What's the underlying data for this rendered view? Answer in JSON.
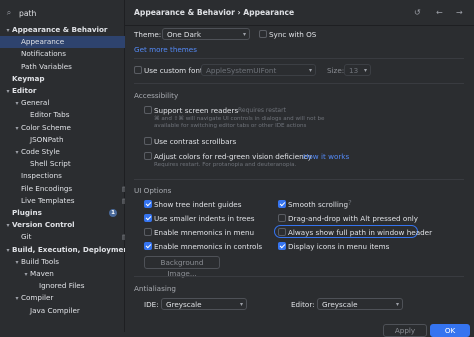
{
  "search": {
    "value": "path"
  },
  "tree": [
    {
      "label": "Appearance & Behavior",
      "arrow": "▾"
    },
    {
      "label": "Appearance"
    },
    {
      "label": "Notifications"
    },
    {
      "label": "Path Variables"
    },
    {
      "label": "Keymap"
    },
    {
      "label": "Editor",
      "arrow": "▾"
    },
    {
      "label": "General",
      "arrow": "▾"
    },
    {
      "label": "Editor Tabs"
    },
    {
      "label": "Color Scheme",
      "arrow": "▾"
    },
    {
      "label": "JSONPath"
    },
    {
      "label": "Code Style",
      "arrow": "▾"
    },
    {
      "label": "Shell Script"
    },
    {
      "label": "Inspections"
    },
    {
      "label": "File Encodings"
    },
    {
      "label": "Live Templates"
    },
    {
      "label": "Plugins",
      "badge": "1"
    },
    {
      "label": "Version Control",
      "arrow": "▾"
    },
    {
      "label": "Git"
    },
    {
      "label": "Build, Execution, Deployment",
      "arrow": "▾"
    },
    {
      "label": "Build Tools",
      "arrow": "▾"
    },
    {
      "label": "Maven",
      "arrow": "▾"
    },
    {
      "label": "Ignored Files"
    },
    {
      "label": "Compiler",
      "arrow": "▾"
    },
    {
      "label": "Java Compiler"
    }
  ],
  "header": {
    "breadcrumb": "Appearance & Behavior  ›  Appearance"
  },
  "theme": {
    "label": "Theme:",
    "value": "One Dark",
    "sync_label": "Sync with OS",
    "get_more": "Get more themes"
  },
  "font": {
    "label": "Use custom font:",
    "value": "AppleSystemUIFont",
    "size_label": "Size:",
    "size_value": "13"
  },
  "accessibility": {
    "title": "Accessibility",
    "screen_readers": "Support screen readers",
    "requires_restart": "Requires restart",
    "screen_readers_note_1": "⌘ and ⇧⌘ will navigate UI controls in dialogs and will not be",
    "screen_readers_note_2": "available for switching editor tabs or other IDE actions",
    "contrast": "Use contrast scrollbars",
    "color_def": "Adjust colors for red-green vision deficiency",
    "how_it_works": "How it works",
    "color_note": "Requires restart. For protanopia and deuteranopia."
  },
  "ui_options": {
    "title": "UI Options",
    "tree_guides": "Show tree indent guides",
    "smaller_indents": "Use smaller indents in trees",
    "mnemonics_menu": "Enable mnemonics in menu",
    "mnemonics_controls": "Enable mnemonics in controls",
    "bg_image": "Background Image...",
    "smooth_scrolling": "Smooth scrolling",
    "drag_drop": "Drag-and-drop with Alt pressed only",
    "full_path": "Always show full path in window header",
    "display_icons": "Display icons in menu items"
  },
  "antialiasing": {
    "title": "Antialiasing",
    "ide_label": "IDE:",
    "ide_value": "Greyscale",
    "editor_label": "Editor:",
    "editor_value": "Greyscale"
  },
  "buttons": {
    "apply": "Apply",
    "ok": "OK"
  }
}
